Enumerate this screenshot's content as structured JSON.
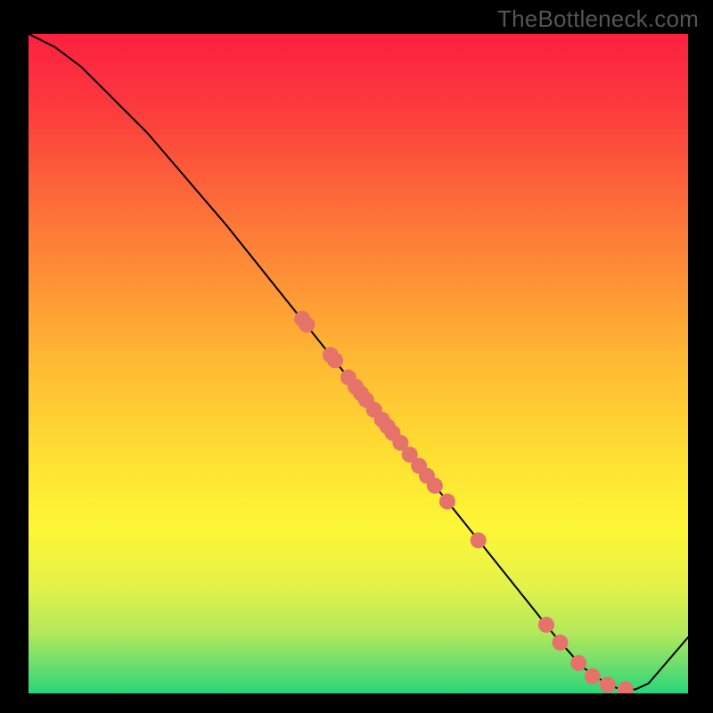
{
  "watermark": "TheBottleneck.com",
  "colors": {
    "gradient_top": "#fc2040",
    "gradient_mid_upper": "#fd7b38",
    "gradient_mid": "#fee233",
    "gradient_lower": "#e3f24a",
    "gradient_bottom": "#27d67a",
    "curve_stroke": "#000000",
    "point_fill": "#e5736a",
    "background": "#000000"
  },
  "chart_data": {
    "type": "line",
    "title": "",
    "xlabel": "",
    "ylabel": "",
    "xlim": [
      0,
      100
    ],
    "ylim": [
      0,
      100
    ],
    "series": [
      {
        "name": "curve",
        "x": [
          0,
          4,
          8,
          12,
          18,
          30,
          40,
          50,
          58,
          66,
          74,
          80,
          84,
          88,
          90,
          92,
          94,
          100
        ],
        "y": [
          100,
          98,
          95,
          91,
          85,
          71,
          58.5,
          46,
          36,
          26,
          16,
          8.5,
          4,
          1.2,
          0.6,
          0.6,
          1.5,
          8.5
        ]
      }
    ],
    "points": [
      {
        "x": 41.5,
        "y": 56.8
      },
      {
        "x": 42.2,
        "y": 55.9
      },
      {
        "x": 45.8,
        "y": 51.3
      },
      {
        "x": 46.5,
        "y": 50.5
      },
      {
        "x": 48.5,
        "y": 47.9
      },
      {
        "x": 49.6,
        "y": 46.5
      },
      {
        "x": 50.4,
        "y": 45.5
      },
      {
        "x": 51.2,
        "y": 44.5
      },
      {
        "x": 52.4,
        "y": 43.0
      },
      {
        "x": 53.6,
        "y": 41.5
      },
      {
        "x": 54.4,
        "y": 40.5
      },
      {
        "x": 55.2,
        "y": 39.5
      },
      {
        "x": 56.4,
        "y": 38.0
      },
      {
        "x": 57.8,
        "y": 36.2
      },
      {
        "x": 59.2,
        "y": 34.5
      },
      {
        "x": 60.4,
        "y": 33.0
      },
      {
        "x": 61.6,
        "y": 31.5
      },
      {
        "x": 63.5,
        "y": 29.1
      },
      {
        "x": 68.2,
        "y": 23.2
      },
      {
        "x": 78.5,
        "y": 10.4
      },
      {
        "x": 80.6,
        "y": 7.7
      },
      {
        "x": 83.4,
        "y": 4.6
      },
      {
        "x": 85.5,
        "y": 2.6
      },
      {
        "x": 87.8,
        "y": 1.3
      },
      {
        "x": 90.5,
        "y": 0.6
      }
    ],
    "annotations": []
  }
}
